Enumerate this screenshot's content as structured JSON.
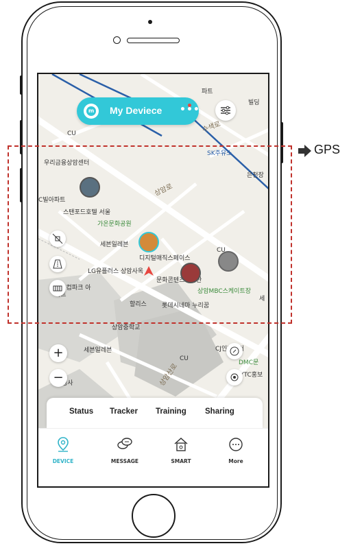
{
  "map": {
    "labels": [
      "CU",
      "우리금융상암센터",
      "C빌아파트",
      "스탠포드호텔 서울",
      "가온문화공원",
      "세븐일레븐",
      "디지털매직스페이스",
      "LG유플러스 상암사옥",
      "문화콘텐츠도서관",
      "상암MBC스케이트장",
      "할리스",
      "롯데시네마 누리꿈",
      "상암중학교",
      "세븐일레븐",
      "CU",
      "CJ인재센터",
      "DMC문",
      "YTC홍보",
      "SK주유소",
      "은천장",
      "상암로",
      "상암산로",
      "수색로",
      "파트",
      "빌딩",
      "CU",
      "월드컵파크 아파트",
      "정사",
      "세"
    ]
  },
  "header": {
    "device_title": "My Deviece",
    "more_dots": "•••",
    "logo_text": "m"
  },
  "map_tools": {
    "zoom_in": "+",
    "zoom_out": "−"
  },
  "tabs": [
    "Status",
    "Tracker",
    "Training",
    "Sharing"
  ],
  "bottom_nav": [
    {
      "label": "DEVICE",
      "active": true
    },
    {
      "label": "MESSAGE",
      "active": false
    },
    {
      "label": "SMART",
      "active": false
    },
    {
      "label": "More",
      "active": false
    }
  ],
  "annotation": {
    "gps_label": "GPS"
  },
  "colors": {
    "accent": "#32c8d8",
    "annotation_red": "#c0312b",
    "river_blue": "#2a5fa8"
  }
}
